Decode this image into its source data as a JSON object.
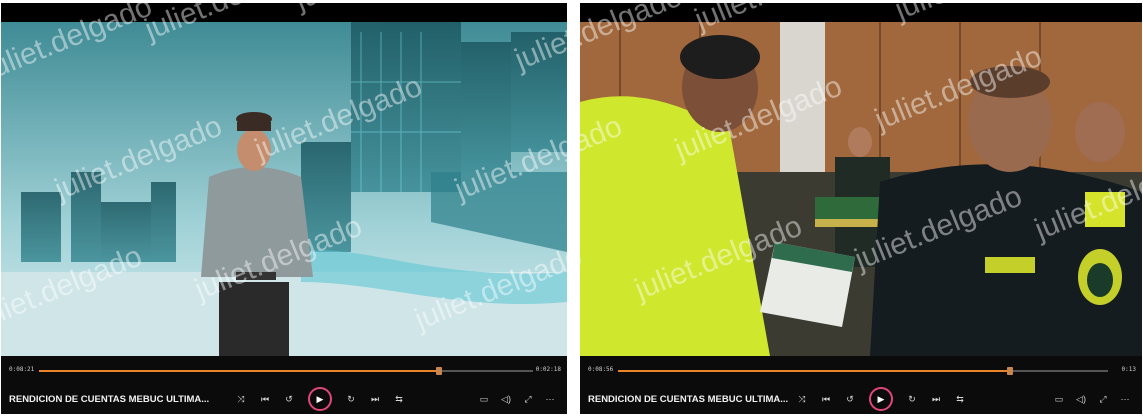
{
  "watermark": "juliet.delgado",
  "players": [
    {
      "current_time": "0:08:21",
      "total_time": "0:02:18",
      "progress": 0.81,
      "title": "RENDICION DE CUENTAS MEBUC ULTIMA...",
      "accent": "#e8842a"
    },
    {
      "current_time": "0:08:56",
      "total_time": "0:13",
      "progress": 0.8,
      "title": "RENDICION DE CUENTAS MEBUC ULTIMA...",
      "accent": "#e8842a"
    }
  ],
  "icons": {
    "shuffle": "⤨",
    "prev": "⏮",
    "back": "↺",
    "play": "▶",
    "forward": "↻",
    "next": "⏭",
    "repeat": "⇆",
    "caption": "▭",
    "volume": "◁)",
    "fullscreen": "⤢",
    "more": "⋯"
  }
}
